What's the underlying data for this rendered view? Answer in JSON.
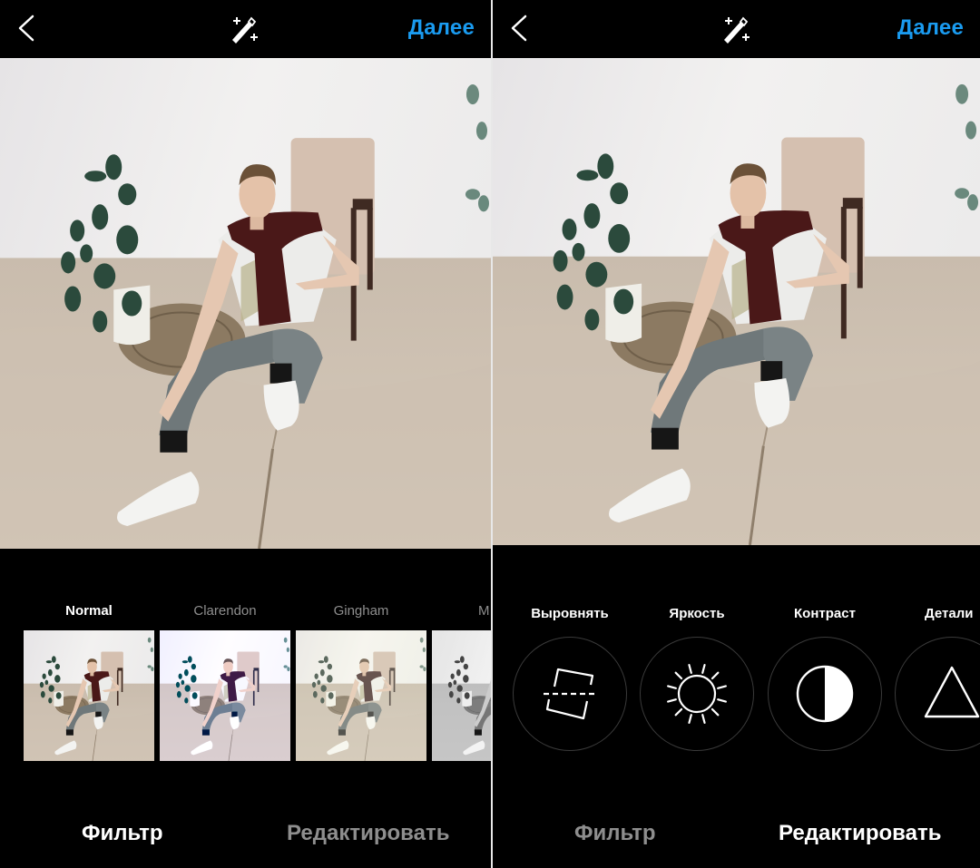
{
  "screens": [
    {
      "header": {
        "back_icon": "chevron-left-icon",
        "wand_icon": "magic-wand-icon",
        "next_label": "Далее"
      },
      "filters": [
        {
          "label": "Normal",
          "active": true,
          "style": "normal"
        },
        {
          "label": "Clarendon",
          "active": false,
          "style": "clarendon"
        },
        {
          "label": "Gingham",
          "active": false,
          "style": "gingham"
        },
        {
          "label": "M",
          "active": false,
          "style": "mono"
        }
      ],
      "tabs": [
        {
          "label": "Фильтр",
          "active": true
        },
        {
          "label": "Редактировать",
          "active": false
        }
      ]
    },
    {
      "header": {
        "back_icon": "chevron-left-icon",
        "wand_icon": "magic-wand-icon",
        "next_label": "Далее"
      },
      "tools": [
        {
          "label": "Выровнять",
          "icon": "straighten-icon"
        },
        {
          "label": "Яркость",
          "icon": "brightness-sun-icon"
        },
        {
          "label": "Контраст",
          "icon": "contrast-half-circle-icon"
        },
        {
          "label": "Детали",
          "icon": "details-triangle-icon"
        }
      ],
      "tabs": [
        {
          "label": "Фильтр",
          "active": false
        },
        {
          "label": "Редактировать",
          "active": true
        }
      ]
    }
  ],
  "colors": {
    "accent": "#1a9bf0",
    "background": "#000000",
    "inactive_text": "#8e8e8e",
    "active_text": "#ffffff",
    "tool_ring": "#3a3a3a"
  }
}
